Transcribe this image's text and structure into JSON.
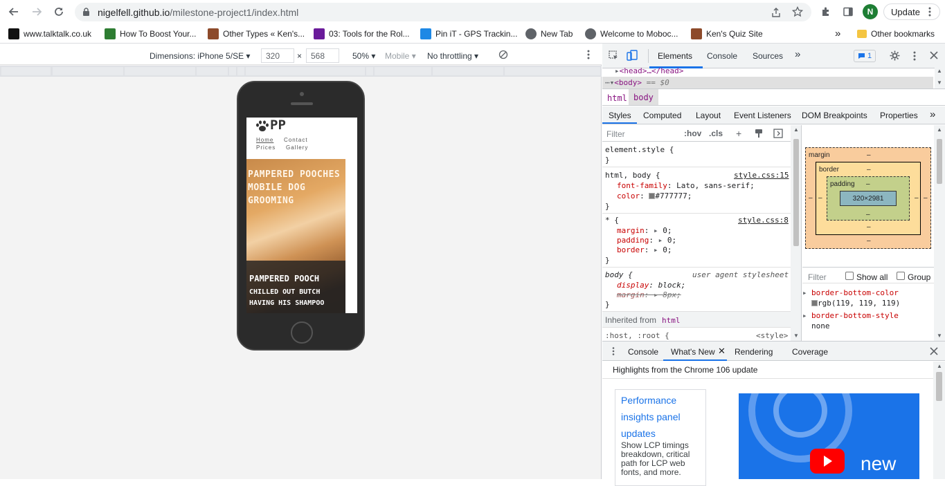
{
  "browser": {
    "url_host": "nigelfell.github.io",
    "url_path": "/milestone-project1/index.html",
    "profile_initial": "N",
    "update_label": "Update",
    "bookmarks": [
      {
        "label": "www.talktalk.co.uk",
        "color": "#111111"
      },
      {
        "label": "How To Boost Your...",
        "color": "#2e7d32"
      },
      {
        "label": "Other Types « Ken's...",
        "color": "#8d4a2a"
      },
      {
        "label": "03: Tools for the Rol...",
        "color": "#6a1b9a"
      },
      {
        "label": "Pin iT - GPS Trackin...",
        "color": "#1e88e5"
      },
      {
        "label": "New Tab",
        "color": "#5f6368"
      },
      {
        "label": "Welcome to Moboc...",
        "color": "#5f6368"
      },
      {
        "label": "Ken's Quiz Site",
        "color": "#8d4a2a"
      }
    ],
    "more_bookmarks": "»",
    "other_bookmarks": "Other bookmarks"
  },
  "device_toolbar": {
    "dimensions": "Dimensions: iPhone 5/SE",
    "width": "320",
    "times": "×",
    "height": "568",
    "zoom": "50%",
    "mode": "Mobile",
    "throttling": "No throttling"
  },
  "site": {
    "logo": "PP",
    "nav": [
      "Home",
      "Contact",
      "Prices",
      "Gallery"
    ],
    "hero_title": "PAMPERED POOCHES MOBILE DOG GROOMING",
    "caption_title": "PAMPERED POOCH",
    "caption_sub1": "CHILLED OUT BUTCH",
    "caption_sub2": "HAVING HIS SHAMPOO"
  },
  "devtools": {
    "tabs": [
      "Elements",
      "Console",
      "Sources"
    ],
    "more": "»",
    "issues_count": "1",
    "dom": {
      "head": "<head>…</head>",
      "body": "<body>",
      "body_hint": "== $0"
    },
    "breadcrumb": [
      "html",
      "body"
    ],
    "subtabs": [
      "Styles",
      "Computed",
      "Layout",
      "Event Listeners",
      "DOM Breakpoints",
      "Properties"
    ],
    "filter_placeholder": "Filter",
    "hov": ":hov",
    "cls": ".cls",
    "rules": {
      "element_style": "element.style {",
      "close": "}",
      "r1_selector": "html, body {",
      "r1_source": "style.css:15",
      "r1_p1_name": "font-family",
      "r1_p1_value": "Lato, sans-serif;",
      "r1_p2_name": "color",
      "r1_p2_value": "#777777;",
      "r2_selector": "* {",
      "r2_source": "style.css:8",
      "r2_p1_name": "margin",
      "r2_p2_name": "padding",
      "r2_p3_name": "border",
      "zero": "0;",
      "r3_selector": "body {",
      "r3_source": "user agent stylesheet",
      "r3_p1_name": "display",
      "r3_p1_value": "block;",
      "r3_p2_name": "margin",
      "r3_p2_value": "8px;",
      "inherited_label": "Inherited from",
      "inherited_tag": "html",
      "r4_selector": ":host, :root {",
      "r4_source": "<style>"
    },
    "boxmodel": {
      "margin": "margin",
      "border": "border",
      "padding": "padding",
      "content": "320×2981",
      "dash": "–"
    },
    "computed_filter": "Filter",
    "show_all": "Show all",
    "group": "Group",
    "computed": [
      {
        "name": "border-bottom-color",
        "value": "rgb(119, 119, 119)"
      },
      {
        "name": "border-bottom-style",
        "value": "none"
      }
    ],
    "drawer_tabs": [
      "Console",
      "What's New",
      "Rendering",
      "Coverage"
    ],
    "whatsnew_title": "Highlights from the Chrome 106 update",
    "card_title": "Performance insights panel updates",
    "card_body": "Show LCP timings breakdown, critical path for LCP web fonts, and more.",
    "video_text": "new"
  },
  "colors": {
    "accent": "#1a73e8",
    "prop": "#c80000",
    "swatch": "#777777"
  }
}
